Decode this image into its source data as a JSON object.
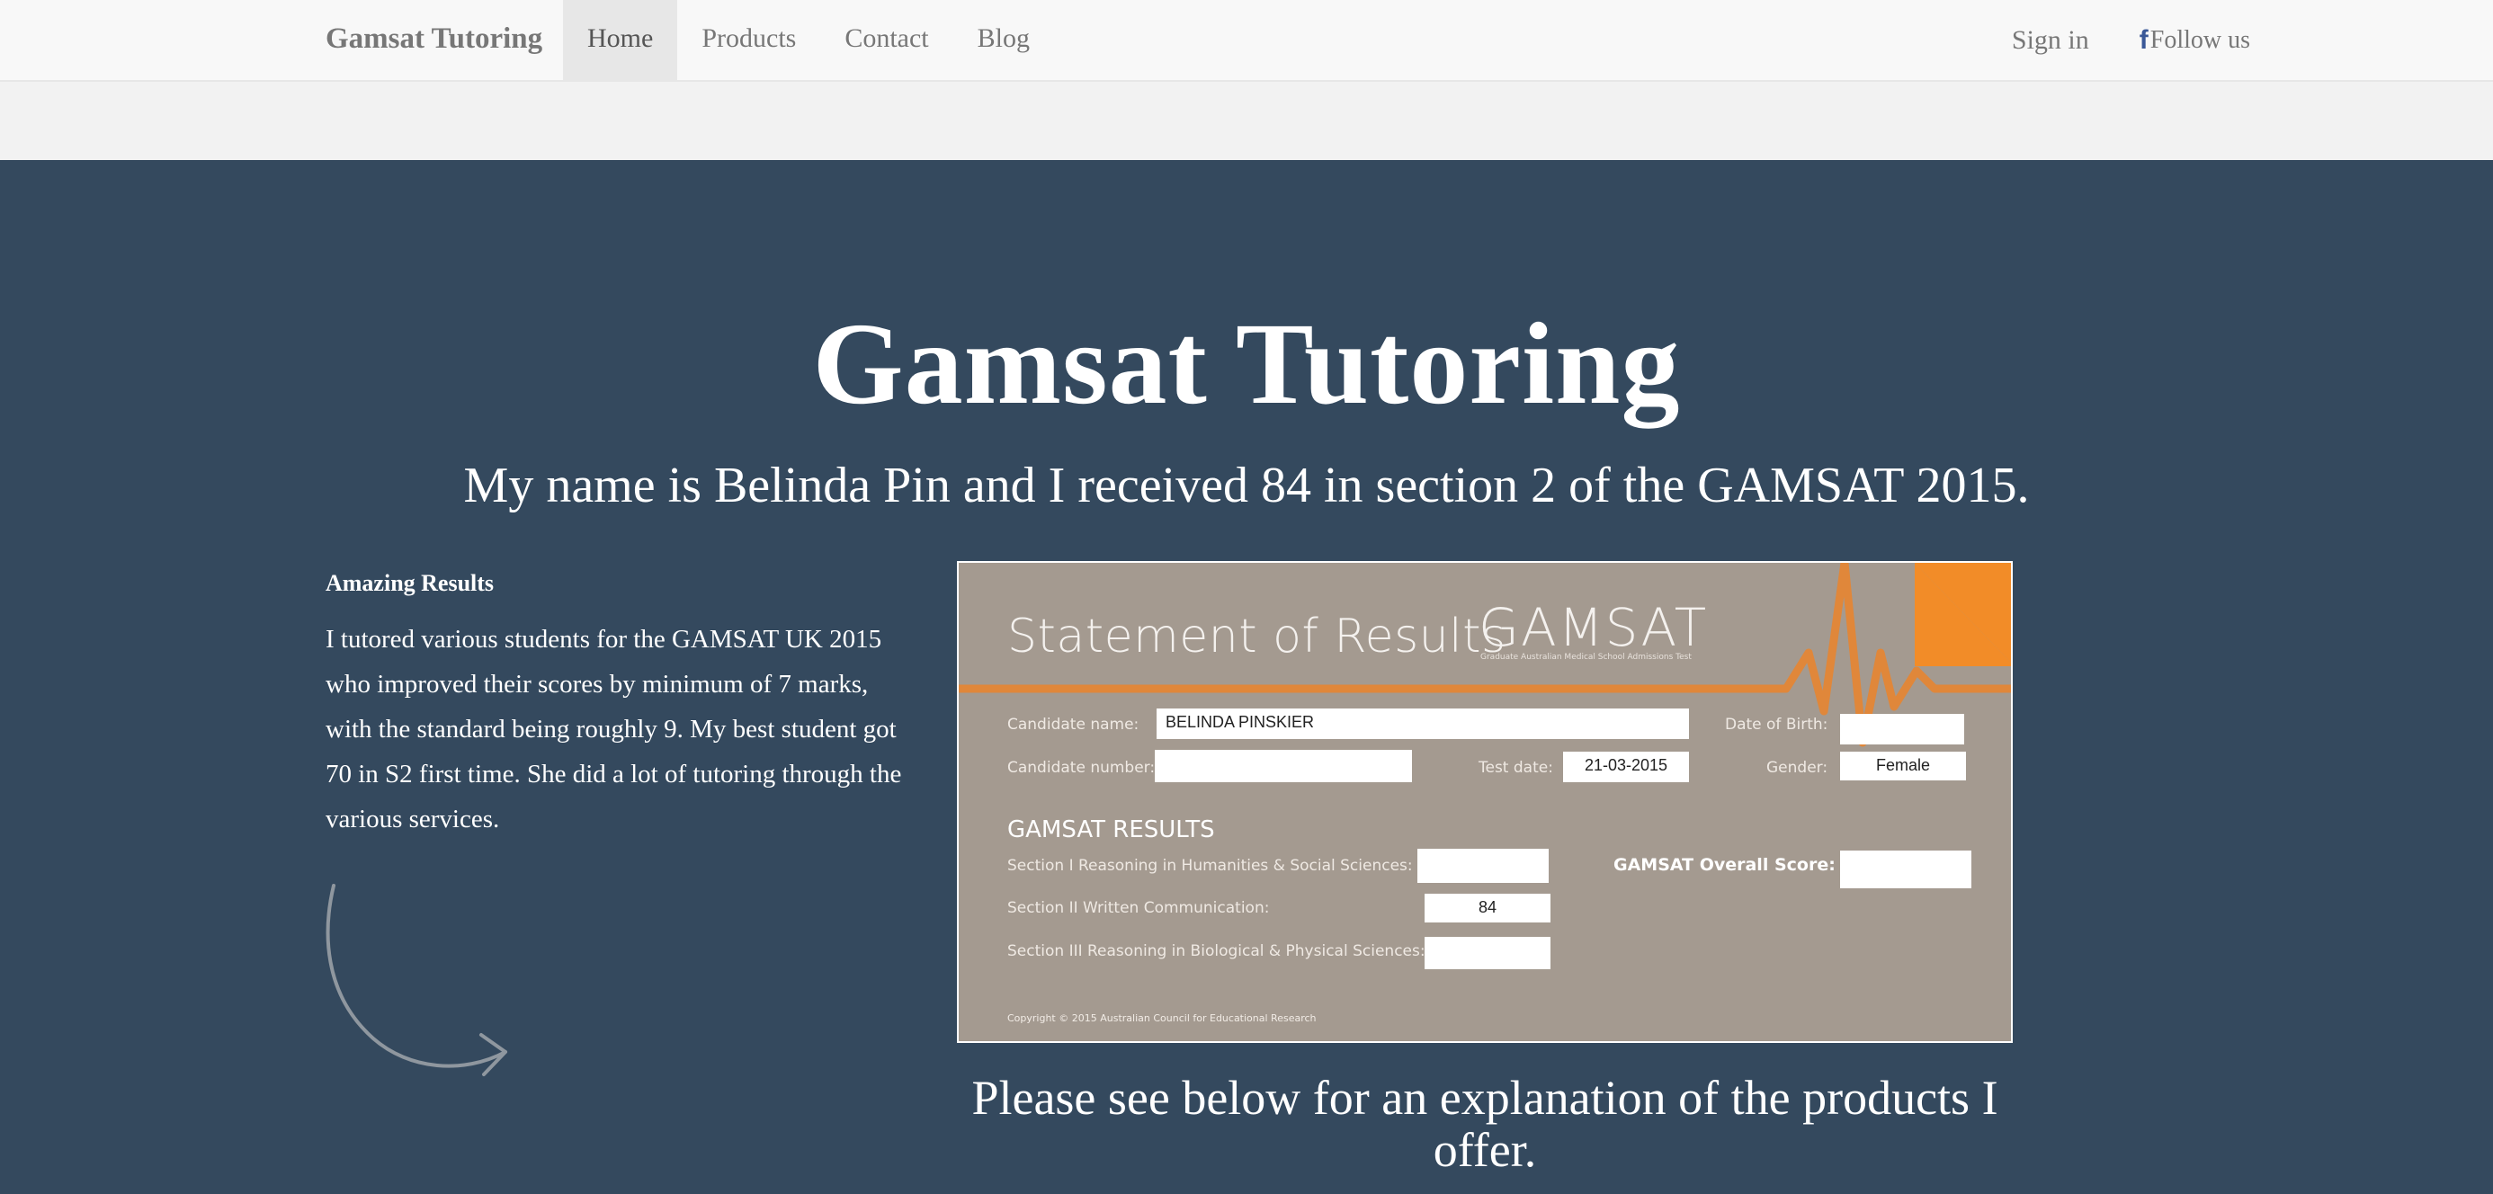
{
  "navbar": {
    "brand": "Gamsat Tutoring",
    "links": [
      {
        "label": "Home",
        "active": true
      },
      {
        "label": "Products",
        "active": false
      },
      {
        "label": "Contact",
        "active": false
      },
      {
        "label": "Blog",
        "active": false
      }
    ],
    "sign_in": "Sign in",
    "follow_us": "Follow us",
    "follow_icon": "facebook-icon"
  },
  "hero": {
    "title": "Gamsat Tutoring",
    "subtitle": "My name is Belinda Pin and I received 84 in section 2 of the GAMSAT 2015."
  },
  "results": {
    "heading": "Amazing Results",
    "body": "I tutored various students for the GAMSAT UK 2015 who improved their scores by minimum of 7 marks, with the standard being roughly 9. My best student got 70 in S2 first time. She did a lot of tutoring through the various services."
  },
  "statement": {
    "title": "Statement of Results",
    "logo": "GAMSAT",
    "tagline": "Graduate Australian Medical School Admissions Test",
    "candidate_name_label": "Candidate name:",
    "candidate_name": "BELINDA PINSKIER",
    "dob_label": "Date of Birth:",
    "dob": "",
    "candidate_number_label": "Candidate number:",
    "candidate_number": "",
    "test_date_label": "Test date:",
    "test_date": "21-03-2015",
    "gender_label": "Gender:",
    "gender": "Female",
    "results_title": "GAMSAT RESULTS",
    "section1_label": "Section I Reasoning in Humanities & Social Sciences:",
    "section1": "",
    "section2_label": "Section II Written Communication:",
    "section2": "84",
    "section3_label": "Section III Reasoning in Biological & Physical Sciences:",
    "section3": "",
    "overall_label": "GAMSAT Overall Score:",
    "overall": "",
    "copyright": "Copyright © 2015 Australian Council for Educational Research",
    "accent_color": "#f28c28"
  },
  "explain": "Please see below for an explanation of the products I offer."
}
